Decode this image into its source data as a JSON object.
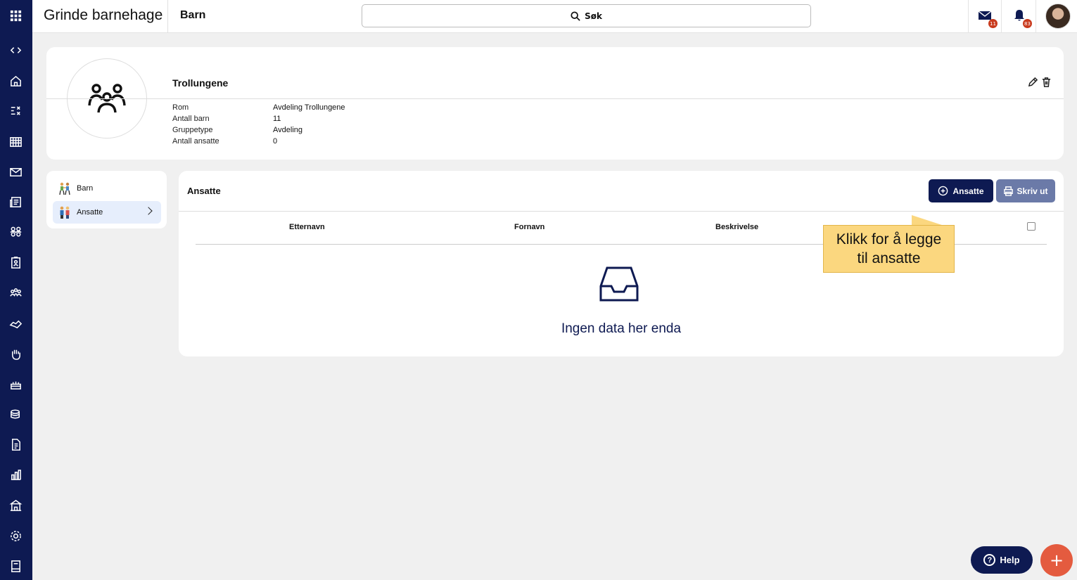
{
  "header": {
    "app_title": "Grinde barnehage",
    "page_title": "Barn",
    "search_label": "Søk",
    "mail_count": "11",
    "notification_count": "83"
  },
  "group": {
    "name": "Trollungene",
    "fields": [
      {
        "label": "Rom",
        "value": "Avdeling Trollungene"
      },
      {
        "label": "Antall barn",
        "value": "11"
      },
      {
        "label": "Gruppetype",
        "value": "Avdeling"
      },
      {
        "label": "Antall ansatte",
        "value": "0"
      }
    ]
  },
  "menu": {
    "items": [
      {
        "label": "Barn",
        "icon": "children-icon",
        "active": false
      },
      {
        "label": "Ansatte",
        "icon": "staff-icon",
        "active": true
      }
    ]
  },
  "panel": {
    "title": "Ansatte",
    "add_button": "Ansatte",
    "print_button": "Skriv ut",
    "columns": [
      "Etternavn",
      "Fornavn",
      "Beskrivelse"
    ],
    "empty_text": "Ingen data her enda"
  },
  "tooltip": {
    "line1": "Klikk for å legge",
    "line2": "til ansatte"
  },
  "help_label": "Help",
  "colors": {
    "sidebar": "#0e1a52",
    "primary": "#0e1a52",
    "secondary": "#6b7aa8",
    "tooltip": "#fbd77f",
    "fab": "#e45b3f",
    "badge": "#c93a1d"
  }
}
